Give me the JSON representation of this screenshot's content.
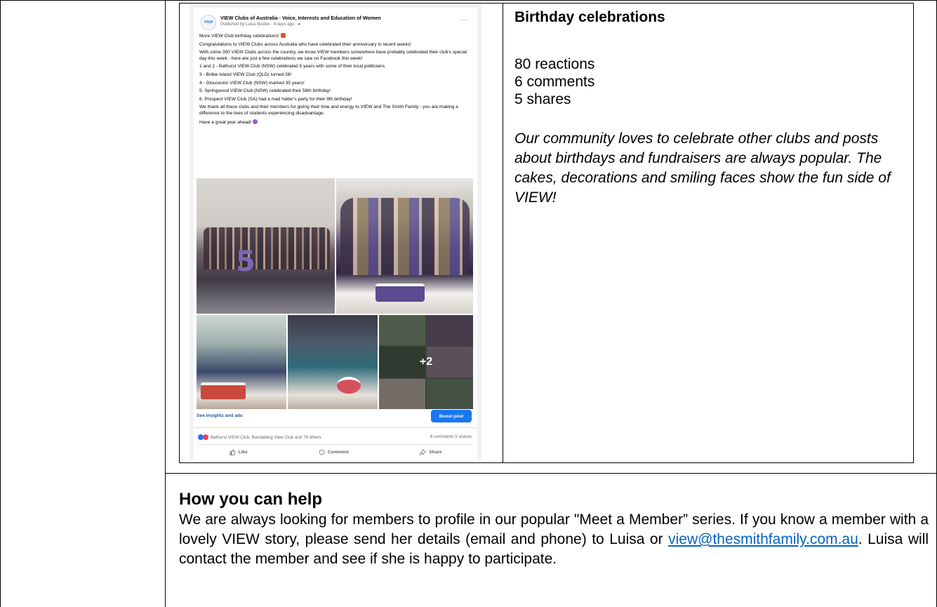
{
  "post": {
    "page_name": "VIEW Clubs of Australia - Voice, Interests and Education of Women",
    "meta": "Published by Luisa Bustos · 4 days ago ·",
    "avatar_text": "VIEW",
    "more_icon": "more-icon",
    "paragraphs": [
      "More VIEW Club birthday celebrations!",
      "Congratulations to VIEW Clubs across Australia who have celebrated their anniversary in recent weeks!",
      "With some 300 VIEW Clubs across the country, we know VIEW members somewhere have probably celebrated their club's special day this week - here are just a few celebrations we saw on Facebook this week!",
      "1 and 2 - Bathurst VIEW Club (NSW) celebrated 5 years with some of their local politicians.",
      "3 - Bribie Island VIEW Club (QLD) turned 28!",
      "4 - Gloucestor VIEW Club (NSW) marked 35 years!",
      "5. Springwood VIEW Club (NSW) celebrated their 58th birthday!",
      "6. Prospect VIEW Club (SA) had a mad hatter's party for their 9th birthday!",
      "We thank all these clubs and their members for giving their time and energy to VIEW and The Smith Family - you are making a difference to the lives of students experiencing disadvantage.",
      "Have a great year ahead!"
    ],
    "photo_number": "5",
    "more_photos": "+2",
    "insights_link": "See insights and ads",
    "boost_button": "Boost post",
    "reactions_text": "Bathurst VIEW Club, Bundaberg View Club and 79 others",
    "counts_text": "6 comments  5 shares",
    "actions": {
      "like": "Like",
      "comment": "Comment",
      "share": "Share"
    }
  },
  "caption": {
    "title": "Birthday celebrations",
    "reactions": "80 reactions",
    "comments": "6 comments",
    "shares": "5 shares",
    "note": "Our community loves to celebrate other clubs and posts about birthdays and fundraisers are always popular. The cakes, decorations and smiling faces show the fun side of VIEW!"
  },
  "help": {
    "title": "How you can help",
    "body_before": "We are always looking for members to profile in our popular \"Meet a Member” series. If you know a member with a lovely VIEW story, please send her details (email and phone) to Luisa or ",
    "email": "view@thesmithfamily.com.au",
    "body_after": ". Luisa will contact the member and see if she is happy to participate."
  },
  "colors": {
    "facebook_blue": "#1877f2",
    "link_blue": "#0563c1"
  }
}
